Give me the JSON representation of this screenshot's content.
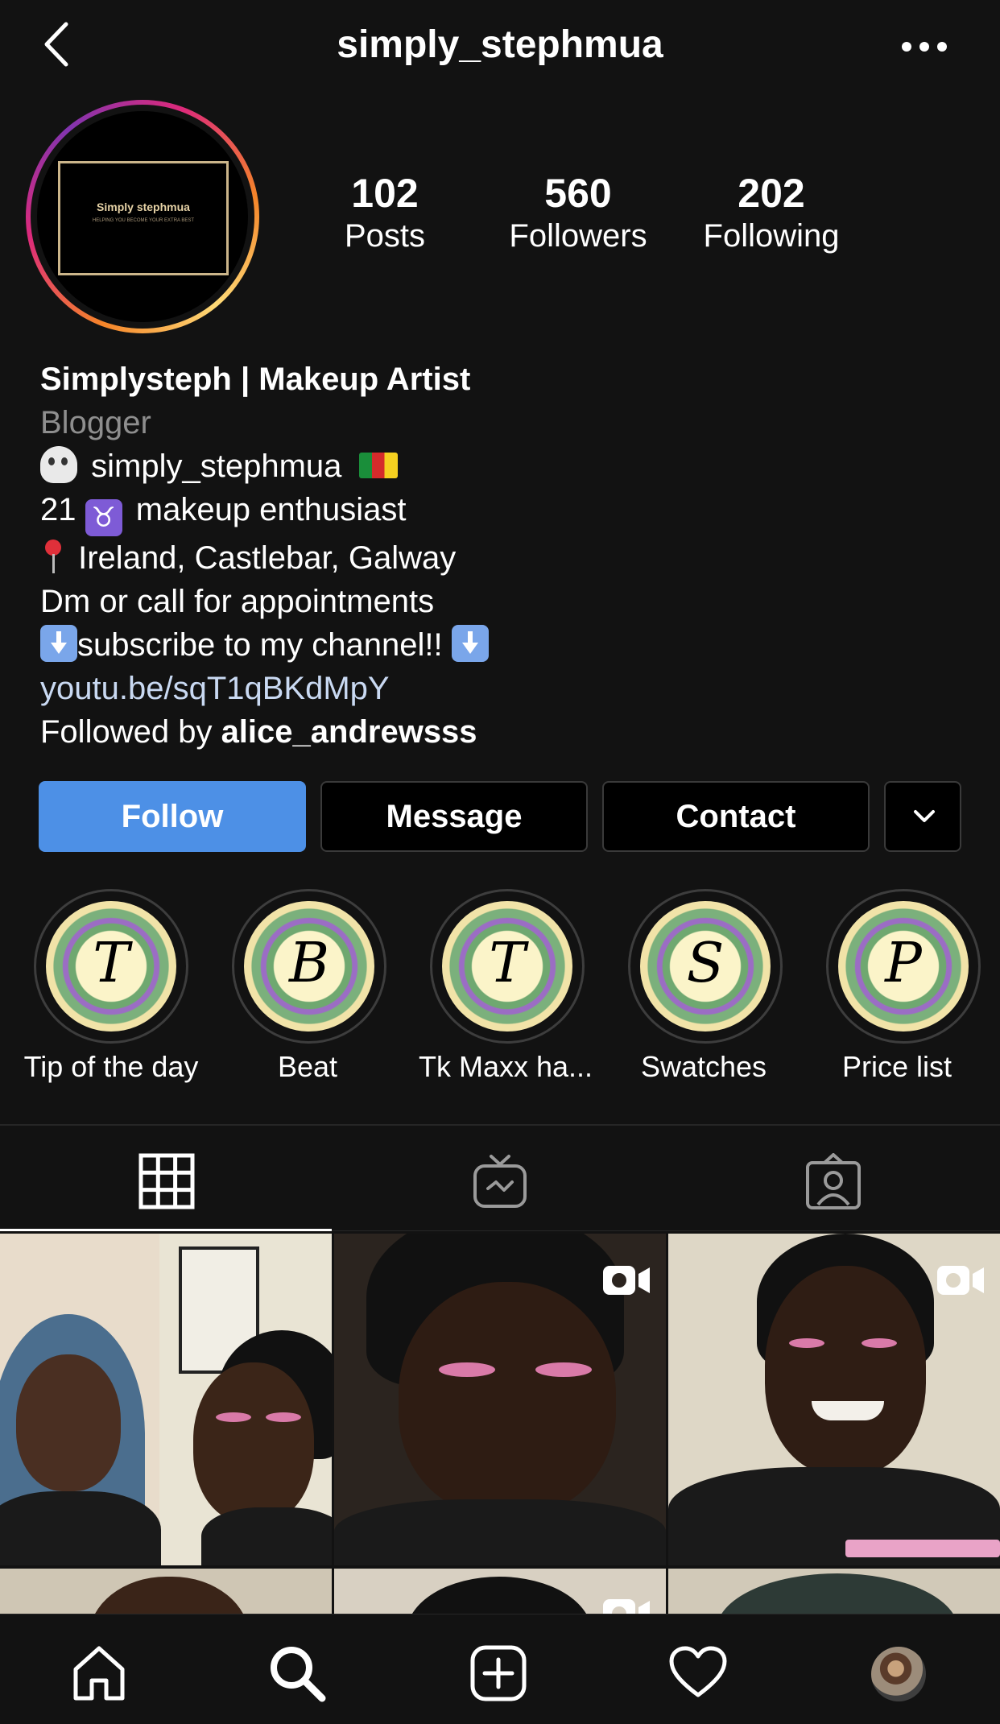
{
  "header": {
    "title": "simply_stephmua"
  },
  "avatar": {
    "logo_title": "Simply stephmua",
    "logo_subtitle": "HELPING YOU BECOME YOUR EXTRA BEST"
  },
  "stats": [
    {
      "value": "102",
      "label": "Posts"
    },
    {
      "value": "560",
      "label": "Followers"
    },
    {
      "value": "202",
      "label": "Following"
    }
  ],
  "bio": {
    "name": "Simplysteph | Makeup Artist",
    "category": "Blogger",
    "line1": "simply_stephmua",
    "line2_prefix": "21",
    "line2_text": "makeup enthusiast",
    "line3": "Ireland, Castlebar, Galway",
    "line4": "Dm or call for appointments",
    "line5": "subscribe to my channel!!",
    "link": "youtu.be/sqT1qBKdMpY",
    "followed_by_prefix": "Followed by",
    "followed_by_user": "alice_andrewsss"
  },
  "buttons": {
    "follow": "Follow",
    "message": "Message",
    "contact": "Contact"
  },
  "highlights": [
    {
      "letter": "T",
      "label": "Tip of the day"
    },
    {
      "letter": "B",
      "label": "Beat"
    },
    {
      "letter": "T",
      "label": "Tk Maxx ha..."
    },
    {
      "letter": "S",
      "label": "Swatches"
    },
    {
      "letter": "P",
      "label": "Price list"
    }
  ],
  "tabs": [
    "grid-icon",
    "igtv-icon",
    "tagged-icon"
  ],
  "nav": [
    "home-icon",
    "search-icon",
    "new-post-icon",
    "activity-heart-icon",
    "profile-avatar"
  ],
  "colors": {
    "background": "#121212",
    "follow_button": "#4d90e6",
    "link": "#c9d9f2",
    "secondary_text": "#8e8e8e"
  }
}
